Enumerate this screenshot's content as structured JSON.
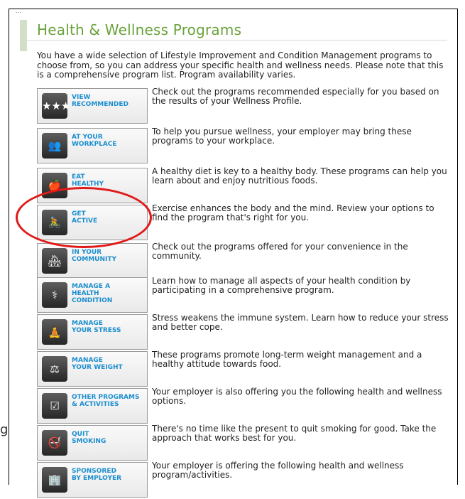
{
  "page": {
    "breadcrumb_text": "...",
    "title": "Health & Wellness Programs",
    "intro": "You have a wide selection of Lifestyle Improvement and Condition Management programs to choose from, so you can address your specific health and wellness needs. Please note that this is a comprehensive program list. Program availability varies.",
    "stray_letter": "g"
  },
  "programs": [
    {
      "label": "VIEW\nRECOMMENDED",
      "icon": "three-stars-icon",
      "glyph": "★★★",
      "desc": "Check out the programs recommended especially for you based on the results of your Wellness Profile."
    },
    {
      "label": "AT YOUR\nWORKPLACE",
      "icon": "people-group-icon",
      "glyph": "👥",
      "desc": "To help you pursue wellness, your employer may bring these programs to your workplace."
    },
    {
      "label": "EAT\nHEALTHY",
      "icon": "apple-icon",
      "glyph": "🍎",
      "desc": "A healthy diet is key to a healthy body. These programs can help you learn about and enjoy nutritious foods."
    },
    {
      "label": "GET\nACTIVE",
      "icon": "cyclist-icon",
      "glyph": "🚴",
      "desc": "Exercise enhances the body and the mind. Review your options to find the program that's right for you."
    },
    {
      "label": "IN YOUR\nCOMMUNITY",
      "icon": "houses-icon",
      "glyph": "🏘",
      "desc": "Check out the programs offered for your convenience in the community."
    },
    {
      "label": "MANAGE A\nHEALTH\nCONDITION",
      "icon": "doctor-icon",
      "glyph": "⚕",
      "desc": "Learn how to manage all aspects of your health condition by participating in a comprehensive program."
    },
    {
      "label": "MANAGE\nYOUR STRESS",
      "icon": "meditation-icon",
      "glyph": "🧘",
      "desc": "Stress weakens the immune system. Learn how to reduce your stress and better cope."
    },
    {
      "label": "MANAGE\nYOUR WEIGHT",
      "icon": "scale-icon",
      "glyph": "⚖",
      "desc": "These programs promote long-term weight management and a healthy attitude towards food."
    },
    {
      "label": "OTHER PROGRAMS\n& ACTIVITIES",
      "icon": "checklist-icon",
      "glyph": "☑",
      "desc": "Your employer is also offering you the following health and wellness options."
    },
    {
      "label": "QUIT\nSMOKING",
      "icon": "no-smoking-icon",
      "glyph": "🚭",
      "desc": "There's no time like the present to quit smoking for good. Take the approach that works best for you."
    },
    {
      "label": "SPONSORED\nBY EMPLOYER",
      "icon": "building-icon",
      "glyph": "🏢",
      "desc": "Your employer is offering the following health and wellness program/activities."
    }
  ],
  "colors": {
    "title_green": "#6aa23a",
    "label_blue": "#1b8ecf",
    "annotation_red": "#e01919"
  }
}
